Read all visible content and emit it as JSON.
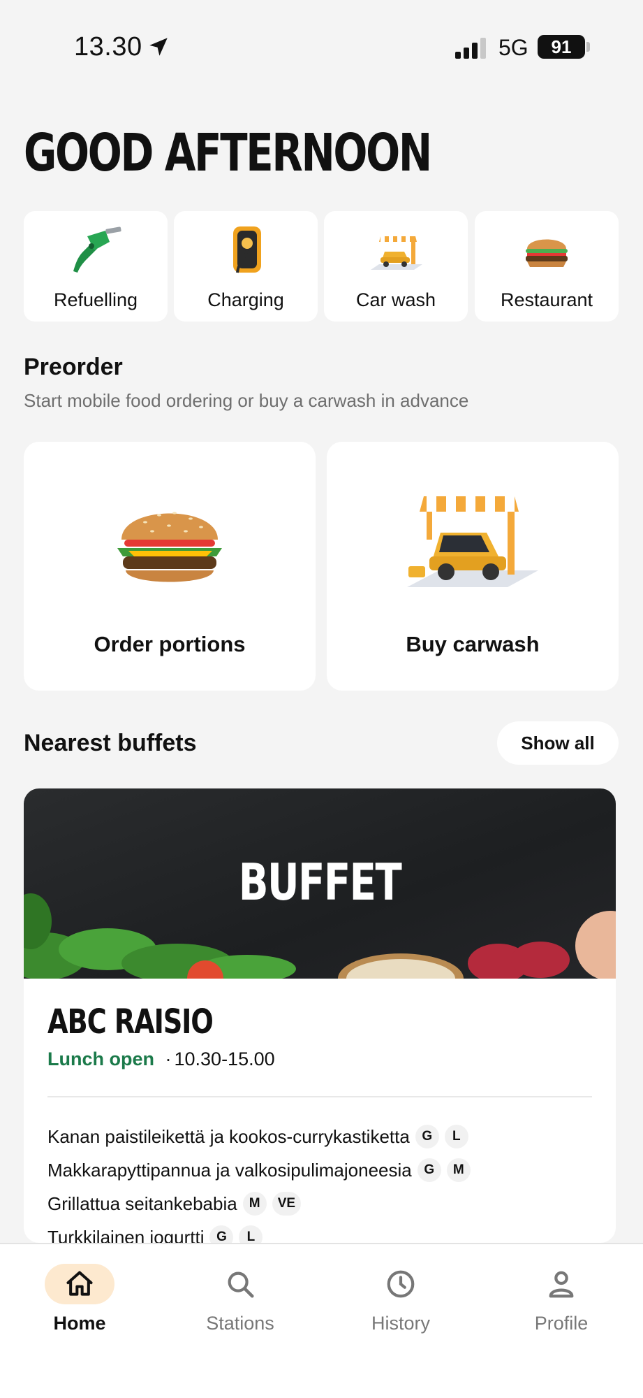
{
  "status_bar": {
    "time": "13.30",
    "network": "5G",
    "battery": "91"
  },
  "greeting": "GOOD AFTERNOON",
  "quick_actions": [
    {
      "label": "Refuelling",
      "icon": "fuel-nozzle-icon"
    },
    {
      "label": "Charging",
      "icon": "ev-charger-icon"
    },
    {
      "label": "Car wash",
      "icon": "car-wash-icon"
    },
    {
      "label": "Restaurant",
      "icon": "burger-icon"
    }
  ],
  "preorder": {
    "title": "Preorder",
    "subtitle": "Start mobile food ordering or buy a carwash in advance",
    "cards": [
      {
        "label": "Order portions",
        "icon": "burger-icon"
      },
      {
        "label": "Buy carwash",
        "icon": "car-wash-icon"
      }
    ]
  },
  "buffets": {
    "title": "Nearest buffets",
    "show_all": "Show all",
    "card": {
      "banner_text": "BUFFET",
      "name": "ABC RAISIO",
      "status": "Lunch open",
      "separator": "·",
      "hours": "10.30-15.00",
      "menu": [
        {
          "dish": "Kanan paistileikettä ja kookos-currykastiketta",
          "tags": [
            "G",
            "L"
          ]
        },
        {
          "dish": "Makkarapyttipannua ja valkosipulimajoneesia",
          "tags": [
            "G",
            "M"
          ]
        },
        {
          "dish": "Grillattua seitankebabia",
          "tags": [
            "M",
            "VE"
          ]
        },
        {
          "dish": "Turkkilainen jogurtti",
          "tags": [
            "G",
            "L"
          ]
        }
      ]
    }
  },
  "tabbar": [
    {
      "label": "Home",
      "icon": "home-icon",
      "active": true
    },
    {
      "label": "Stations",
      "icon": "search-icon",
      "active": false
    },
    {
      "label": "History",
      "icon": "clock-icon",
      "active": false
    },
    {
      "label": "Profile",
      "icon": "person-icon",
      "active": false
    }
  ],
  "colors": {
    "accent_green": "#1b7a4a",
    "active_tab_bg": "#fde9cf",
    "background": "#f4f4f4"
  }
}
